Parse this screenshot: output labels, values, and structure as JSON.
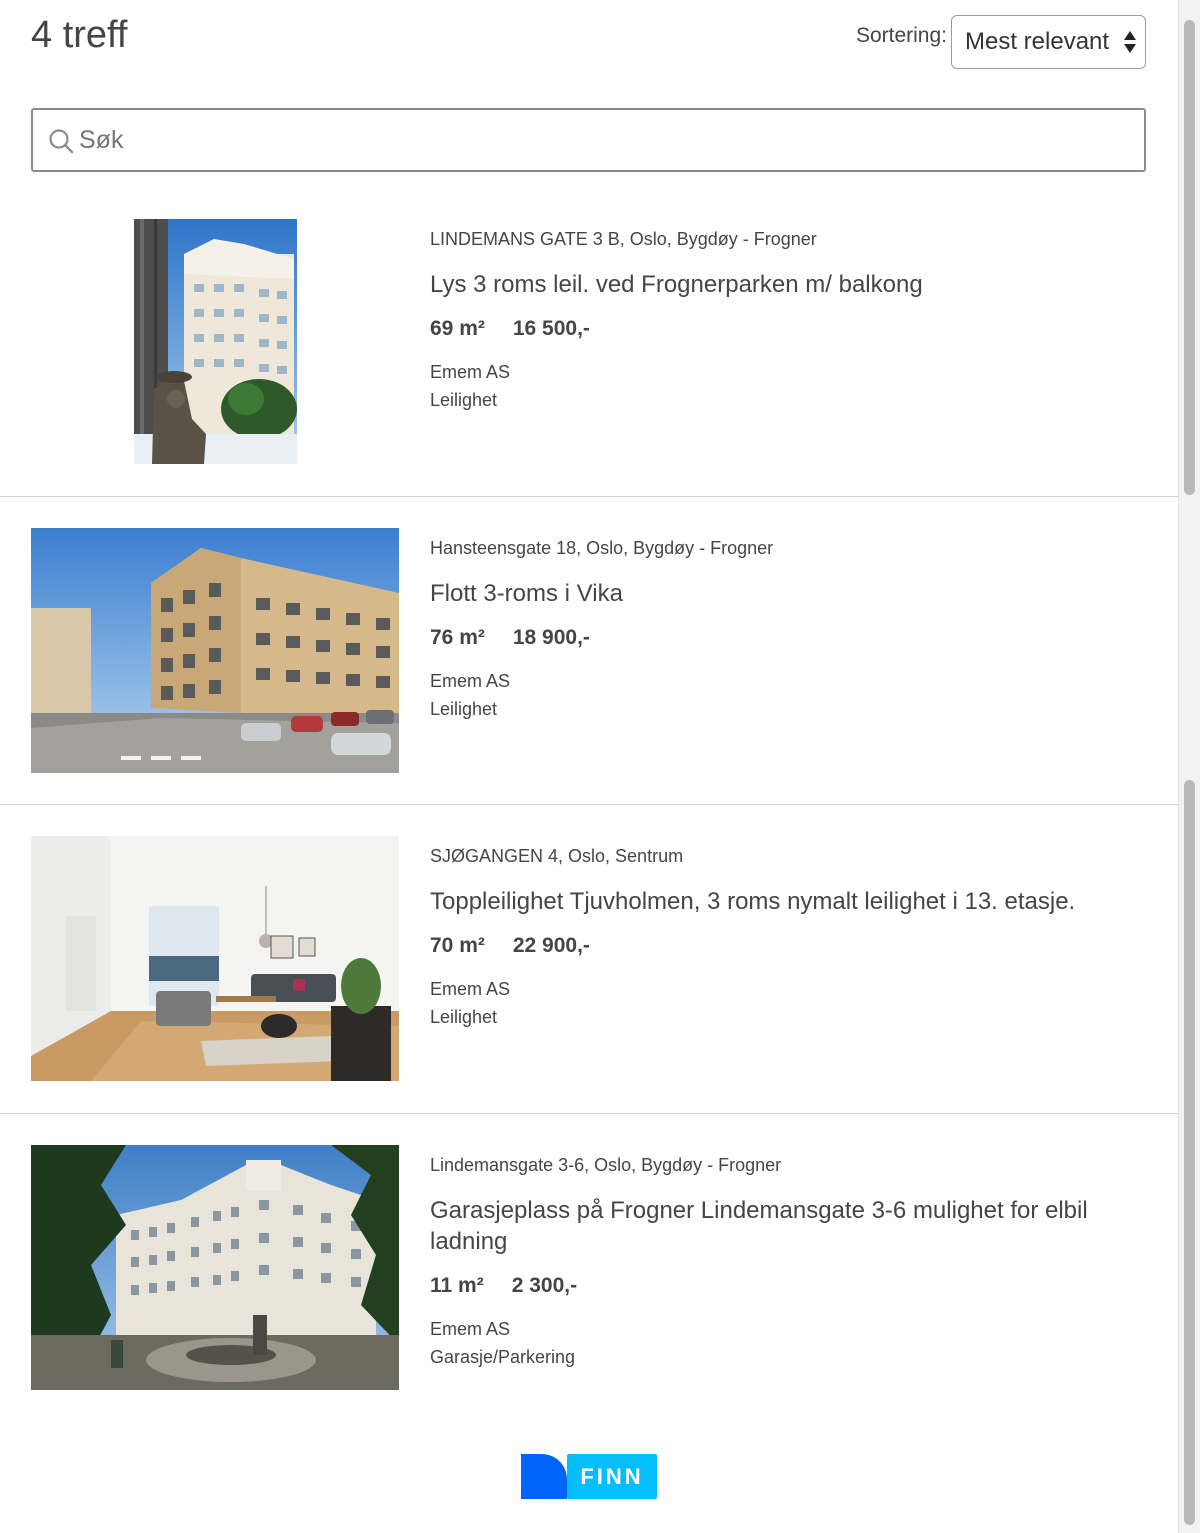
{
  "header": {
    "hits_label": "4 treff",
    "sort_label": "Sortering:",
    "sort_selected": "Mest relevant"
  },
  "search": {
    "placeholder": "Søk",
    "icon": "search-icon"
  },
  "listings": [
    {
      "address": "LINDEMANS GATE 3 B, Oslo, Bygdøy - Frogner",
      "title": "Lys 3 roms leil. ved Frognerparken m/ balkong",
      "area": "69 m²",
      "price": "16 500,-",
      "company": "Emem AS",
      "type": "Leilighet",
      "image": "apartment-building-with-statue-photo"
    },
    {
      "address": "Hansteensgate 18, Oslo, Bygdøy - Frogner",
      "title": "Flott 3-roms i Vika",
      "area": "76 m²",
      "price": "18 900,-",
      "company": "Emem AS",
      "type": "Leilighet",
      "image": "corner-apartment-building-photo"
    },
    {
      "address": "SJØGANGEN 4, Oslo, Sentrum",
      "title": "Toppleilighet Tjuvholmen, 3 roms nymalt leilighet i 13. etasje.",
      "area": "70 m²",
      "price": "22 900,-",
      "company": "Emem AS",
      "type": "Leilighet",
      "image": "living-room-interior-photo"
    },
    {
      "address": "Lindemansgate 3-6, Oslo, Bygdøy - Frogner",
      "title": "Garasjeplass på Frogner Lindemansgate 3-6 mulighet for elbil ladning",
      "area": "11 m²",
      "price": "2 300,-",
      "company": "Emem AS",
      "type": "Garasje/Parkering",
      "image": "courtyard-apartment-building-photo"
    }
  ],
  "footer": {
    "logo_text": "FINN",
    "logo_colors": {
      "dark": "#0063fb",
      "light": "#06befb"
    }
  }
}
